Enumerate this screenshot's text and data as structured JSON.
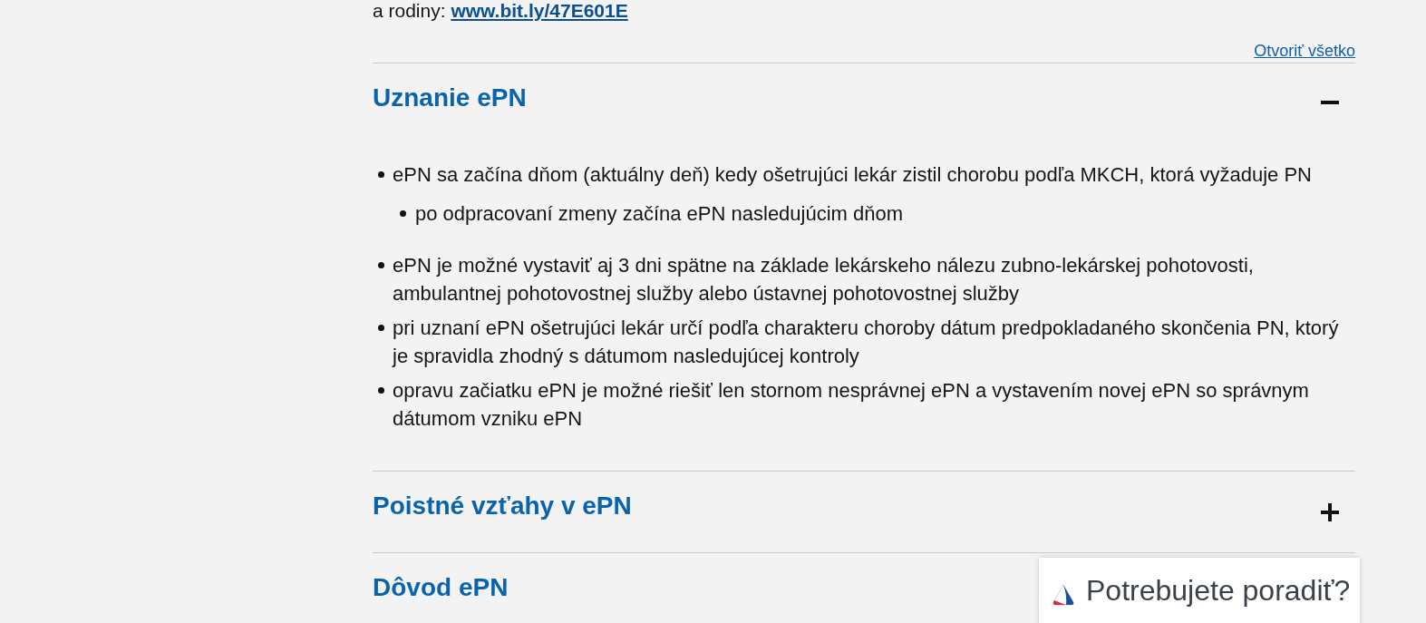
{
  "intro": {
    "text": "a rodiny:",
    "link": "www.bit.ly/47E601E"
  },
  "open_all_link": "Otvoriť všetko",
  "sections": [
    {
      "title": "Uznanie ePN",
      "expanded": true,
      "items": [
        {
          "text": "ePN sa začína dňom (aktuálny deň) kedy ošetrujúci lekár zistil chorobu podľa MKCH, ktorá vyžaduje PN",
          "children": [
            {
              "text": "po odpracovaní zmeny začína ePN nasledujúcim dňom"
            }
          ]
        },
        {
          "text": "ePN je možné vystaviť aj 3 dni spätne na základe lekárskeho nálezu zubno-lekárskej pohotovosti, ambulantnej pohotovostnej služby alebo ústavnej pohotovostnej služby"
        },
        {
          "text": "pri uznaní ePN ošetrujúci lekár určí podľa charakteru choroby dátum predpokladaného skončenia PN, ktorý je spravidla zhodný s dátumom nasledujúcej kontroly"
        },
        {
          "text": "opravu začiatku ePN je možné riešiť len stornom nesprávnej ePN a vystavením novej ePN so správnym dátumom vzniku ePN"
        }
      ]
    },
    {
      "title": "Poistné vzťahy v ePN",
      "expanded": false
    },
    {
      "title": "Dôvod ePN"
    }
  ],
  "help_widget": {
    "label": "Potrebujete poradiť?"
  }
}
